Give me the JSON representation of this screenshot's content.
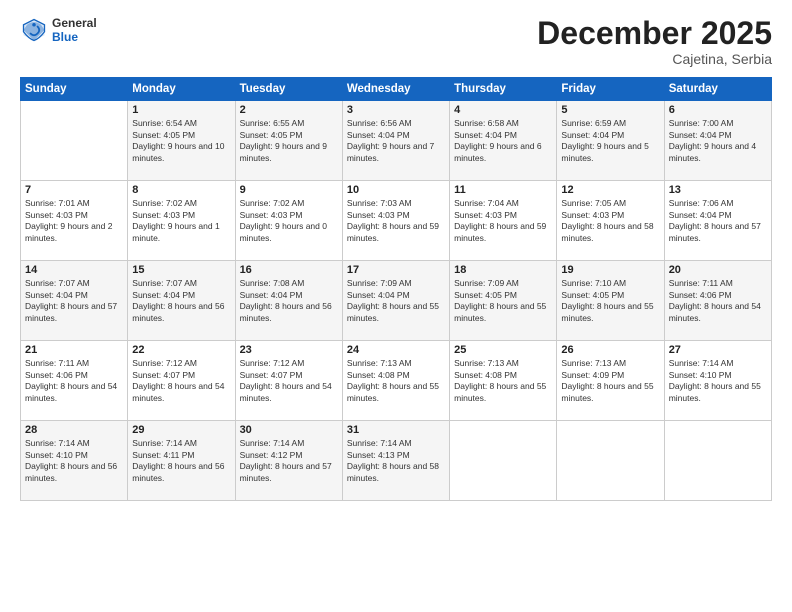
{
  "header": {
    "logo": {
      "general": "General",
      "blue": "Blue"
    },
    "title": "December 2025",
    "subtitle": "Cajetina, Serbia"
  },
  "days_of_week": [
    "Sunday",
    "Monday",
    "Tuesday",
    "Wednesday",
    "Thursday",
    "Friday",
    "Saturday"
  ],
  "weeks": [
    [
      {
        "day": "",
        "empty": true
      },
      {
        "day": "1",
        "sunrise": "6:54 AM",
        "sunset": "4:05 PM",
        "daylight": "9 hours and 10 minutes."
      },
      {
        "day": "2",
        "sunrise": "6:55 AM",
        "sunset": "4:05 PM",
        "daylight": "9 hours and 9 minutes."
      },
      {
        "day": "3",
        "sunrise": "6:56 AM",
        "sunset": "4:04 PM",
        "daylight": "9 hours and 7 minutes."
      },
      {
        "day": "4",
        "sunrise": "6:58 AM",
        "sunset": "4:04 PM",
        "daylight": "9 hours and 6 minutes."
      },
      {
        "day": "5",
        "sunrise": "6:59 AM",
        "sunset": "4:04 PM",
        "daylight": "9 hours and 5 minutes."
      },
      {
        "day": "6",
        "sunrise": "7:00 AM",
        "sunset": "4:04 PM",
        "daylight": "9 hours and 4 minutes."
      }
    ],
    [
      {
        "day": "7",
        "sunrise": "7:01 AM",
        "sunset": "4:03 PM",
        "daylight": "9 hours and 2 minutes."
      },
      {
        "day": "8",
        "sunrise": "7:02 AM",
        "sunset": "4:03 PM",
        "daylight": "9 hours and 1 minute."
      },
      {
        "day": "9",
        "sunrise": "7:02 AM",
        "sunset": "4:03 PM",
        "daylight": "9 hours and 0 minutes."
      },
      {
        "day": "10",
        "sunrise": "7:03 AM",
        "sunset": "4:03 PM",
        "daylight": "8 hours and 59 minutes."
      },
      {
        "day": "11",
        "sunrise": "7:04 AM",
        "sunset": "4:03 PM",
        "daylight": "8 hours and 59 minutes."
      },
      {
        "day": "12",
        "sunrise": "7:05 AM",
        "sunset": "4:03 PM",
        "daylight": "8 hours and 58 minutes."
      },
      {
        "day": "13",
        "sunrise": "7:06 AM",
        "sunset": "4:04 PM",
        "daylight": "8 hours and 57 minutes."
      }
    ],
    [
      {
        "day": "14",
        "sunrise": "7:07 AM",
        "sunset": "4:04 PM",
        "daylight": "8 hours and 57 minutes."
      },
      {
        "day": "15",
        "sunrise": "7:07 AM",
        "sunset": "4:04 PM",
        "daylight": "8 hours and 56 minutes."
      },
      {
        "day": "16",
        "sunrise": "7:08 AM",
        "sunset": "4:04 PM",
        "daylight": "8 hours and 56 minutes."
      },
      {
        "day": "17",
        "sunrise": "7:09 AM",
        "sunset": "4:04 PM",
        "daylight": "8 hours and 55 minutes."
      },
      {
        "day": "18",
        "sunrise": "7:09 AM",
        "sunset": "4:05 PM",
        "daylight": "8 hours and 55 minutes."
      },
      {
        "day": "19",
        "sunrise": "7:10 AM",
        "sunset": "4:05 PM",
        "daylight": "8 hours and 55 minutes."
      },
      {
        "day": "20",
        "sunrise": "7:11 AM",
        "sunset": "4:06 PM",
        "daylight": "8 hours and 54 minutes."
      }
    ],
    [
      {
        "day": "21",
        "sunrise": "7:11 AM",
        "sunset": "4:06 PM",
        "daylight": "8 hours and 54 minutes."
      },
      {
        "day": "22",
        "sunrise": "7:12 AM",
        "sunset": "4:07 PM",
        "daylight": "8 hours and 54 minutes."
      },
      {
        "day": "23",
        "sunrise": "7:12 AM",
        "sunset": "4:07 PM",
        "daylight": "8 hours and 54 minutes."
      },
      {
        "day": "24",
        "sunrise": "7:13 AM",
        "sunset": "4:08 PM",
        "daylight": "8 hours and 55 minutes."
      },
      {
        "day": "25",
        "sunrise": "7:13 AM",
        "sunset": "4:08 PM",
        "daylight": "8 hours and 55 minutes."
      },
      {
        "day": "26",
        "sunrise": "7:13 AM",
        "sunset": "4:09 PM",
        "daylight": "8 hours and 55 minutes."
      },
      {
        "day": "27",
        "sunrise": "7:14 AM",
        "sunset": "4:10 PM",
        "daylight": "8 hours and 55 minutes."
      }
    ],
    [
      {
        "day": "28",
        "sunrise": "7:14 AM",
        "sunset": "4:10 PM",
        "daylight": "8 hours and 56 minutes."
      },
      {
        "day": "29",
        "sunrise": "7:14 AM",
        "sunset": "4:11 PM",
        "daylight": "8 hours and 56 minutes."
      },
      {
        "day": "30",
        "sunrise": "7:14 AM",
        "sunset": "4:12 PM",
        "daylight": "8 hours and 57 minutes."
      },
      {
        "day": "31",
        "sunrise": "7:14 AM",
        "sunset": "4:13 PM",
        "daylight": "8 hours and 58 minutes."
      },
      {
        "day": "",
        "empty": true
      },
      {
        "day": "",
        "empty": true
      },
      {
        "day": "",
        "empty": true
      }
    ]
  ]
}
